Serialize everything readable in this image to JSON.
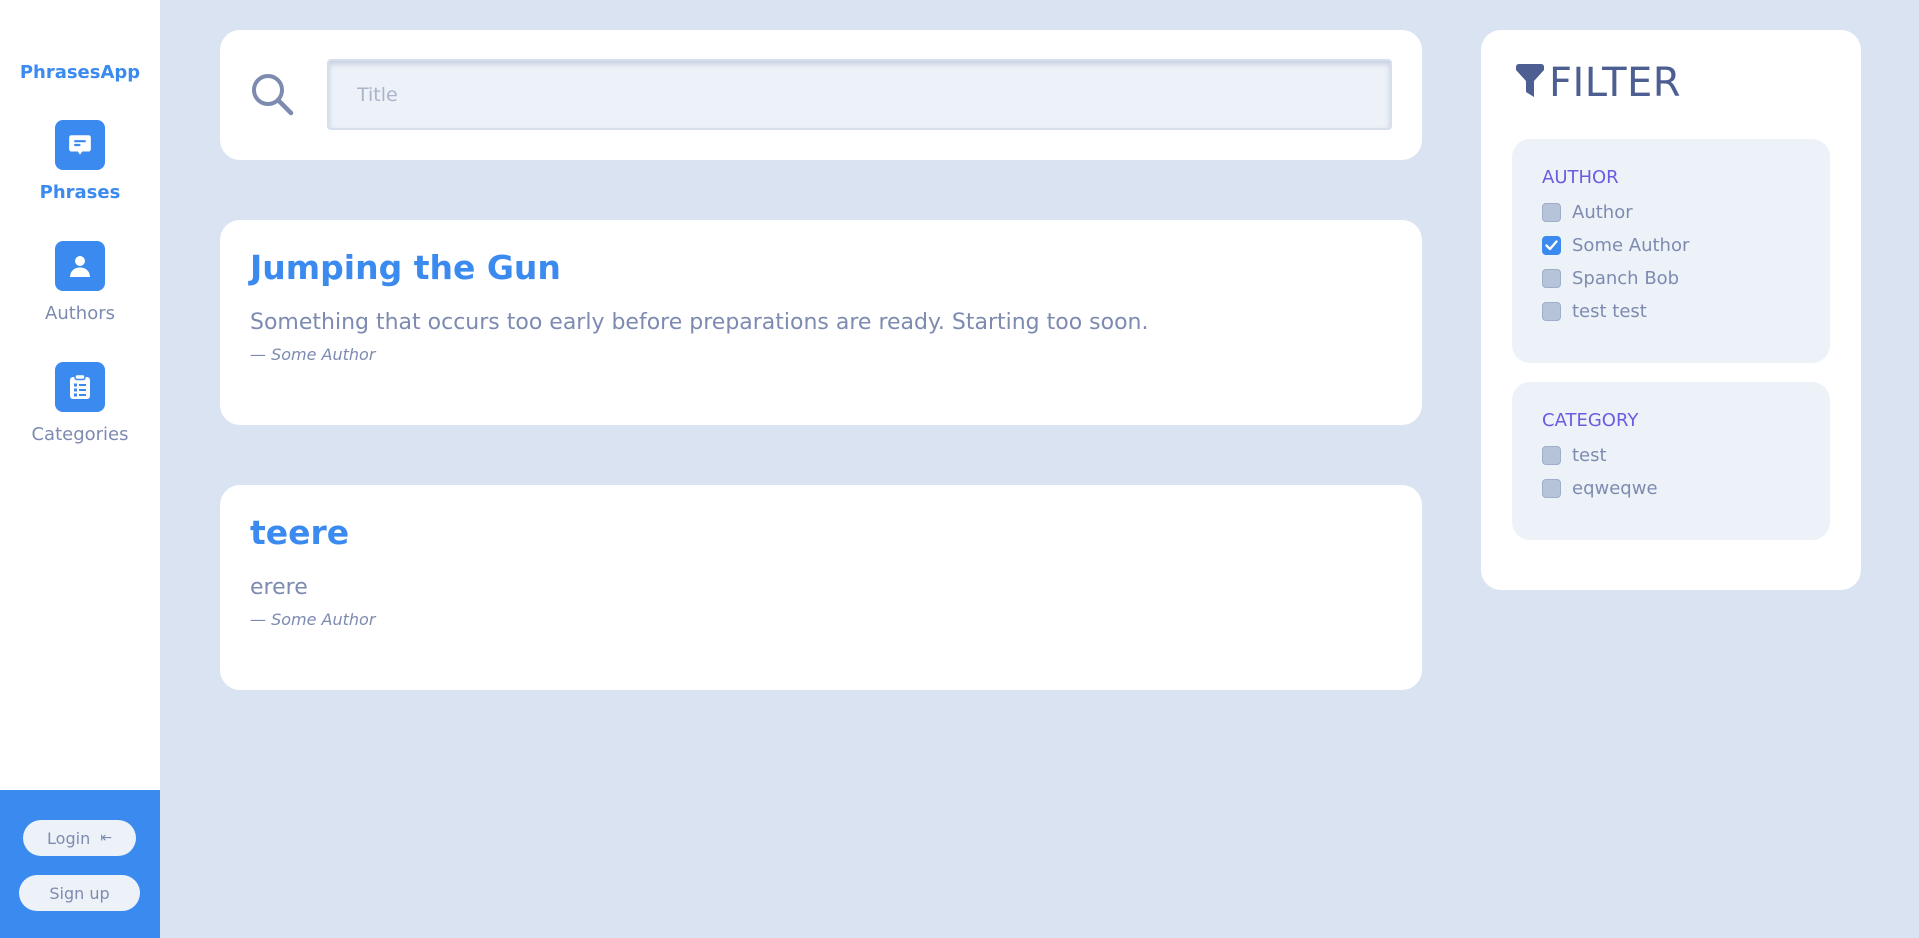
{
  "app": {
    "brand": "PhrasesApp"
  },
  "nav": {
    "items": [
      {
        "label": "Phrases",
        "icon": "message-icon",
        "active": true
      },
      {
        "label": "Authors",
        "icon": "person-icon",
        "active": false
      },
      {
        "label": "Categories",
        "icon": "clipboard-list-icon",
        "active": false
      }
    ]
  },
  "auth": {
    "login_label": "Login",
    "signup_label": "Sign up"
  },
  "search": {
    "placeholder": "Title",
    "value": ""
  },
  "phrases": [
    {
      "title": "Jumping the Gun",
      "text": "Something that occurs too early before preparations are ready. Starting too soon.",
      "author": "— Some Author"
    },
    {
      "title": "teere",
      "text": "erere",
      "author": "— Some Author"
    }
  ],
  "filter": {
    "title": "FILTER",
    "icon": "funnel-icon",
    "author_group": {
      "title": "AUTHOR",
      "options": [
        {
          "label": "Author",
          "checked": false
        },
        {
          "label": "Some Author",
          "checked": true
        },
        {
          "label": "Spanch Bob",
          "checked": false
        },
        {
          "label": "test test",
          "checked": false
        }
      ]
    },
    "category_group": {
      "title": "CATEGORY",
      "options": [
        {
          "label": "test",
          "checked": false
        },
        {
          "label": "eqweqwe",
          "checked": false
        }
      ]
    }
  },
  "colors": {
    "accent": "#3b8af0",
    "background": "#dae3f1",
    "text_muted": "#7d8bb0",
    "group_title": "#6a5ce0"
  }
}
